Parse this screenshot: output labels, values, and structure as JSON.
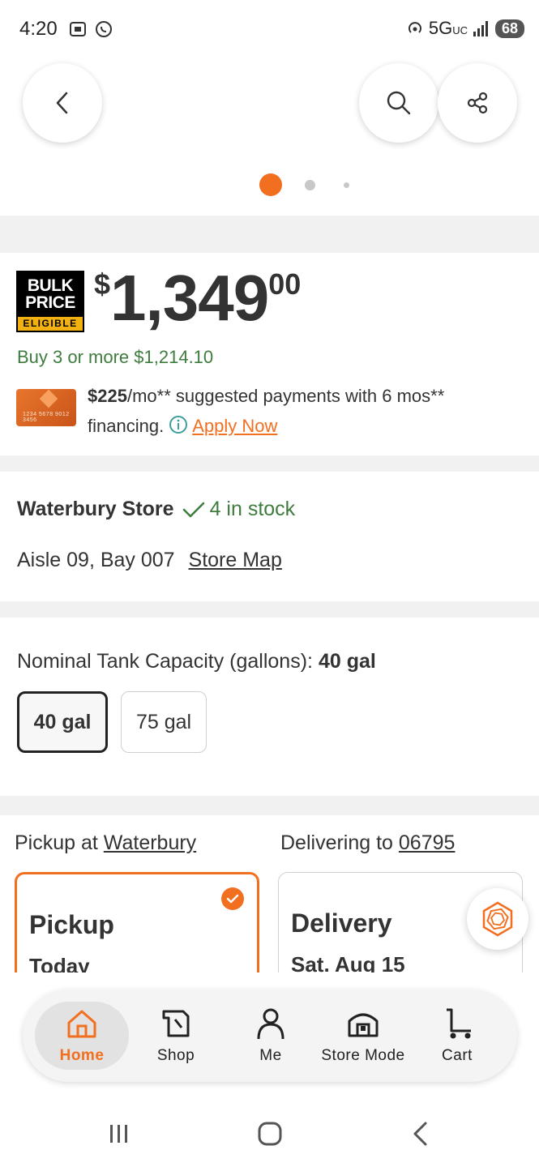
{
  "status_bar": {
    "time": "4:20",
    "network": "5G",
    "network_suffix": "UC",
    "battery": "68"
  },
  "header": {
    "back_icon": "chevron-left-icon",
    "search_icon": "search-icon",
    "share_icon": "share-icon",
    "image_carousel": {
      "count": 3,
      "active_index": 0
    }
  },
  "price": {
    "badge_line1": "BULK",
    "badge_line2": "PRICE",
    "badge_strip": "ELIGIBLE",
    "currency": "$",
    "whole": "1,349",
    "cents": "00",
    "bulk_offer": "Buy 3 or more $1,214.10",
    "financing_amount": "$225",
    "financing_rest_1": "/mo** suggested payments with 6 mos**",
    "financing_rest_2": "financing.",
    "apply_link": "Apply Now"
  },
  "store": {
    "name": "Waterbury Store",
    "stock": "4 in stock",
    "aisle": "Aisle 09, Bay 007",
    "map_link": "Store Map"
  },
  "capacity": {
    "label": "Nominal Tank Capacity (gallons):",
    "selected_value": "40 gal",
    "options": [
      "40 gal",
      "75 gal"
    ]
  },
  "fulfillment": {
    "pickup_prefix": "Pickup at",
    "pickup_store": "Waterbury",
    "delivery_prefix": "Delivering to",
    "delivery_zip": "06795",
    "pickup_title": "Pickup",
    "pickup_when": "Today",
    "delivery_title": "Delivery",
    "delivery_when": "Sat. Aug 15"
  },
  "bottom_nav": {
    "items": [
      {
        "label": "Home",
        "icon": "home-icon",
        "active": true
      },
      {
        "label": "Shop",
        "icon": "shop-icon",
        "active": false
      },
      {
        "label": "Me",
        "icon": "person-icon",
        "active": false
      },
      {
        "label": "Store Mode",
        "icon": "store-icon",
        "active": false
      },
      {
        "label": "Cart",
        "icon": "cart-icon",
        "active": false
      }
    ]
  },
  "colors": {
    "accent": "#f26f20",
    "stock_green": "#3e7c3e",
    "text": "#333333"
  }
}
